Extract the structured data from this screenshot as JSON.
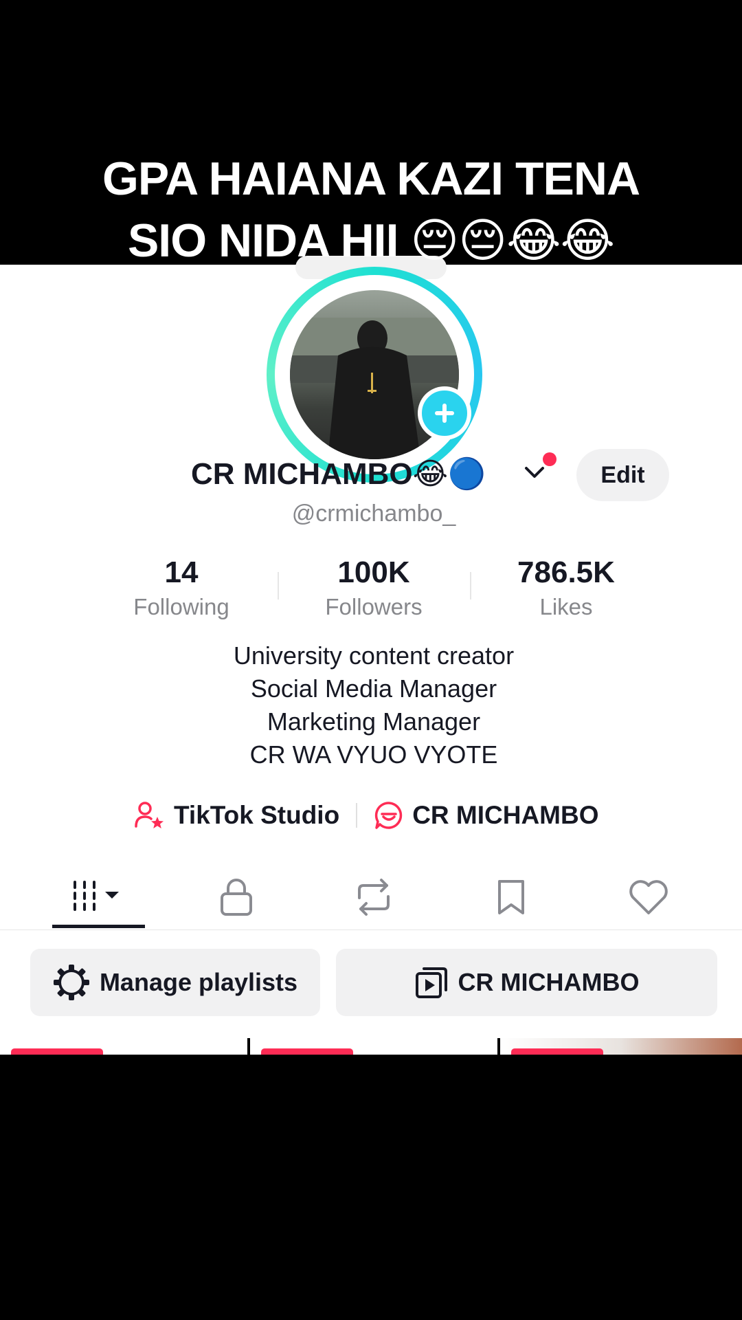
{
  "caption": {
    "line1": "GPA HAIANA KAZI TENA",
    "line2": "SIO NIDA HII 😔😔😂😂"
  },
  "profile": {
    "display_name": "CR MICHAMBO😂🔵",
    "edit_label": "Edit",
    "handle": "@crmichambo_"
  },
  "stats": [
    {
      "value": "14",
      "label": "Following"
    },
    {
      "value": "100K",
      "label": "Followers"
    },
    {
      "value": "786.5K",
      "label": "Likes"
    }
  ],
  "bio": [
    "University content creator",
    "Social Media Manager",
    "Marketing Manager",
    "CR WA VYUO VYOTE"
  ],
  "links": {
    "studio": "TikTok Studio",
    "group": "CR MICHAMBO"
  },
  "tabs": [
    "videos-grid-icon",
    "lock-icon",
    "repost-icon",
    "bookmark-icon",
    "heart-icon"
  ],
  "buttons": {
    "manage_playlists": "Manage playlists",
    "playlist": "CR MICHAMBO"
  },
  "colors": {
    "accent": "#fe2c55",
    "ring": "#1ee0d2",
    "plus": "#2ad3ee",
    "text": "#161823",
    "muted": "#86878b"
  }
}
